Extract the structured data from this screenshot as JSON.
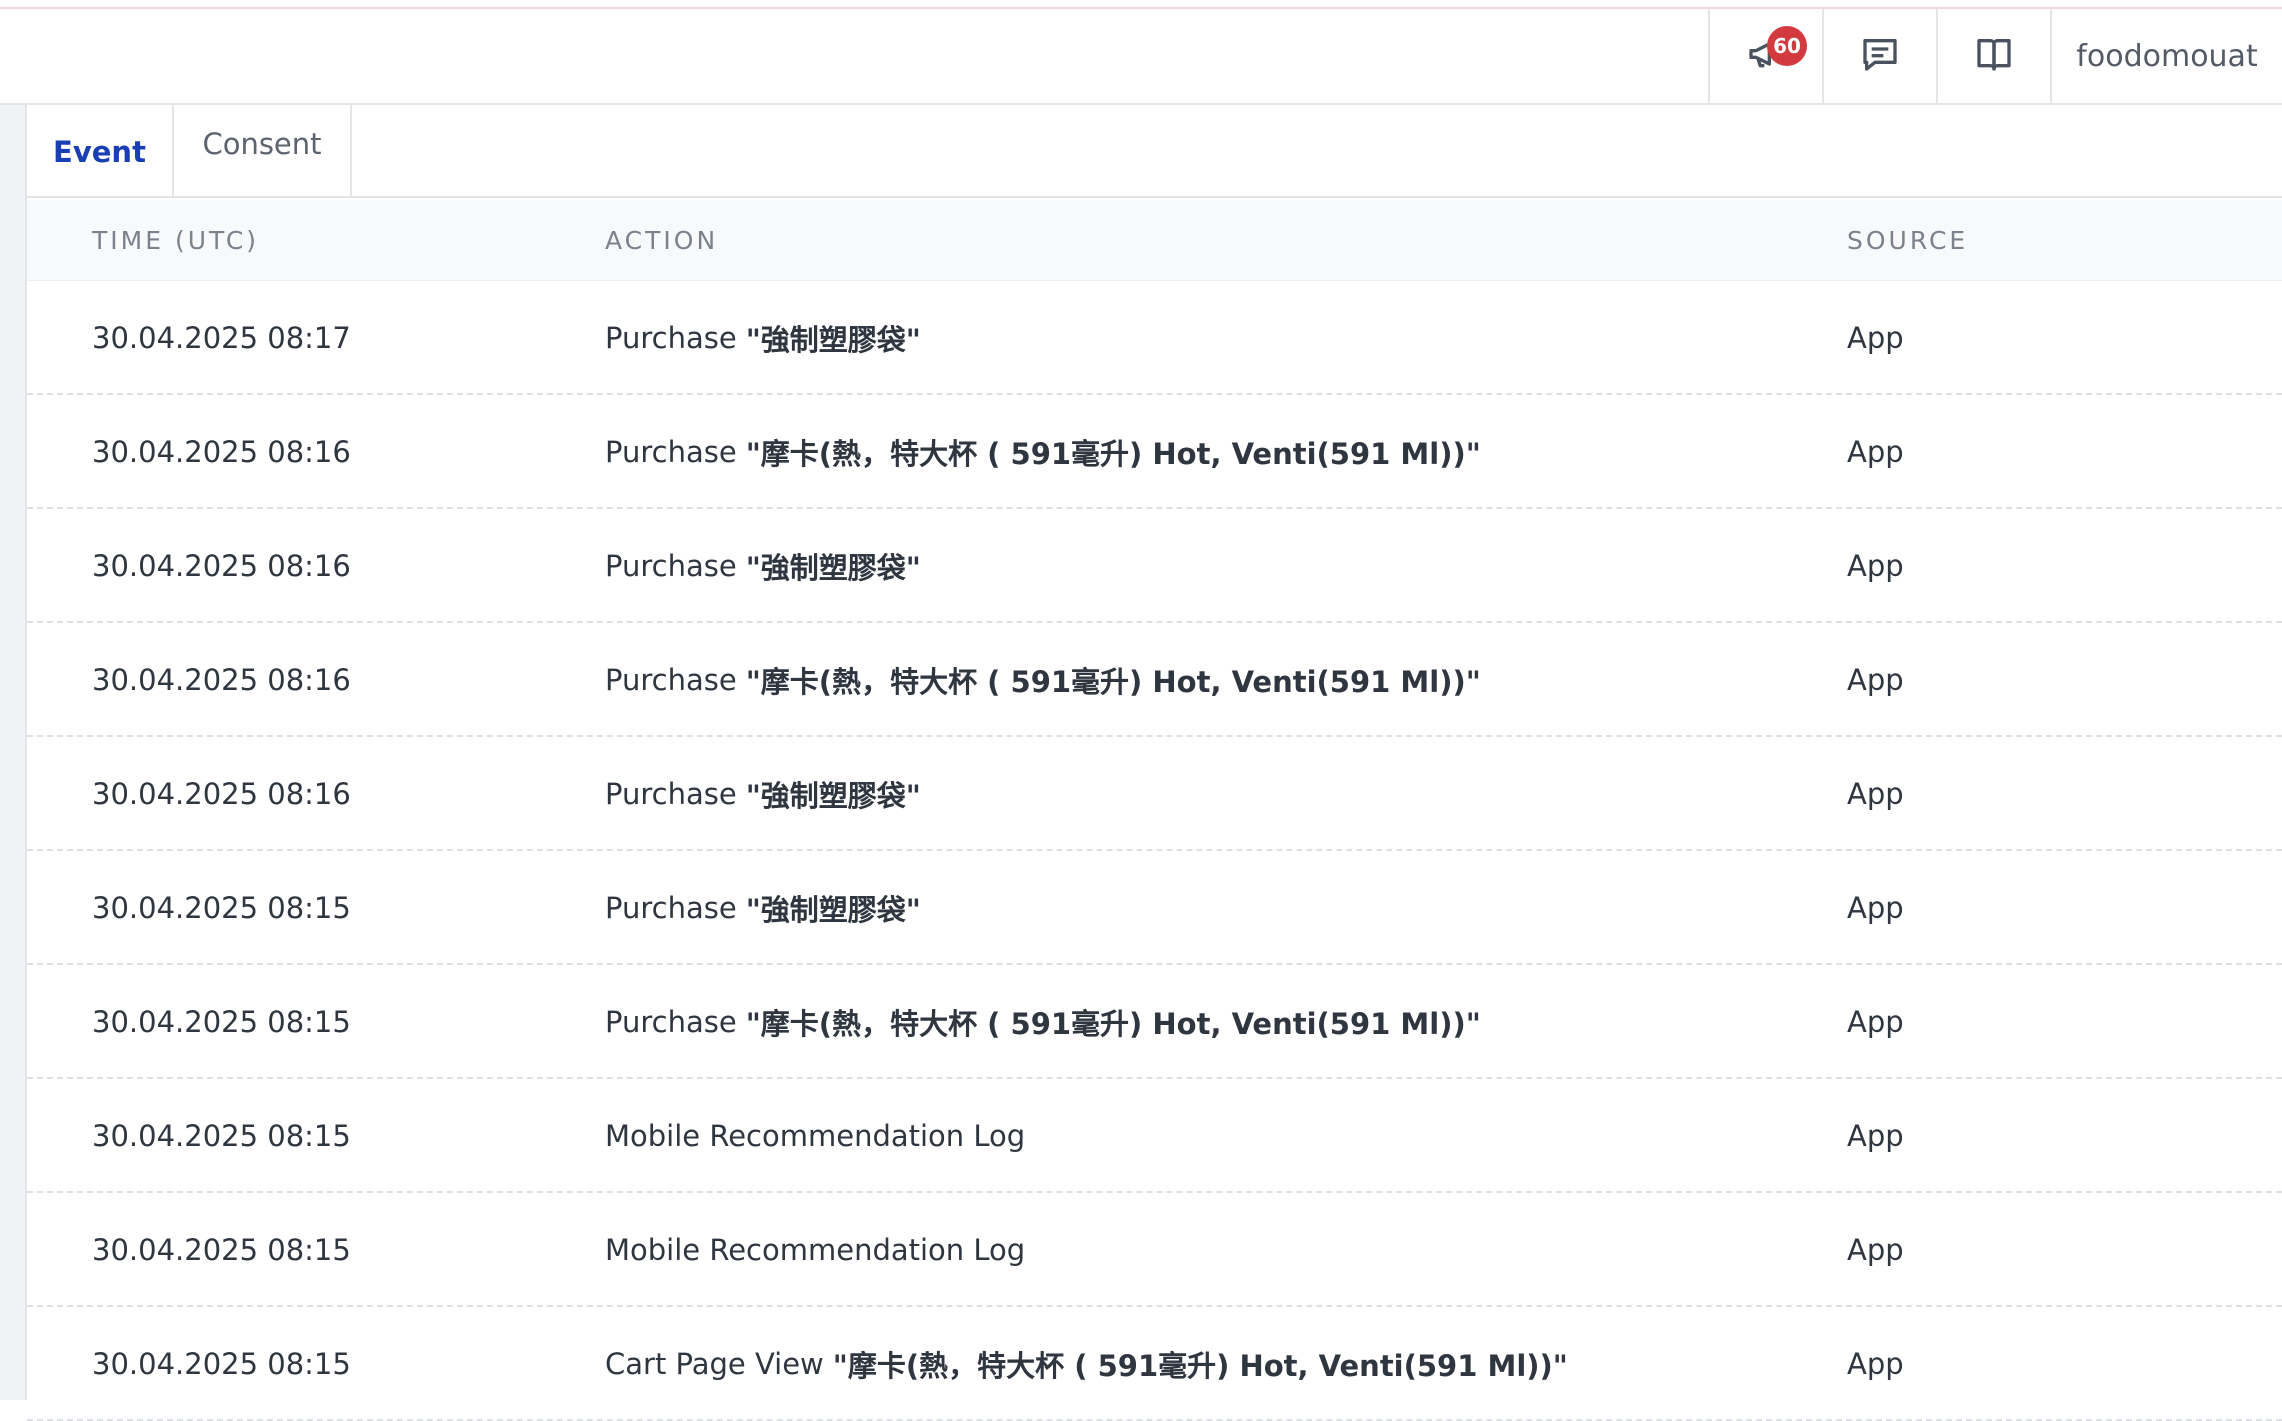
{
  "header": {
    "notification_count": "60",
    "username": "foodomouat"
  },
  "tabs": [
    {
      "label": "Event",
      "active": true
    },
    {
      "label": "Consent",
      "active": false
    }
  ],
  "table": {
    "columns": [
      "TIME (UTC)",
      "ACTION",
      "SOURCE"
    ],
    "rows": [
      {
        "time": "30.04.2025 08:17",
        "action": "Purchase",
        "item": "\"強制塑膠袋\"",
        "source": "App"
      },
      {
        "time": "30.04.2025 08:16",
        "action": "Purchase",
        "item": "\"摩卡(熱，特大杯 ( 591毫升) Hot, Venti(591 Ml))\"",
        "source": "App"
      },
      {
        "time": "30.04.2025 08:16",
        "action": "Purchase",
        "item": "\"強制塑膠袋\"",
        "source": "App"
      },
      {
        "time": "30.04.2025 08:16",
        "action": "Purchase",
        "item": "\"摩卡(熱，特大杯 ( 591毫升) Hot, Venti(591 Ml))\"",
        "source": "App"
      },
      {
        "time": "30.04.2025 08:16",
        "action": "Purchase",
        "item": "\"強制塑膠袋\"",
        "source": "App"
      },
      {
        "time": "30.04.2025 08:15",
        "action": "Purchase",
        "item": "\"強制塑膠袋\"",
        "source": "App"
      },
      {
        "time": "30.04.2025 08:15",
        "action": "Purchase",
        "item": "\"摩卡(熱，特大杯 ( 591毫升) Hot, Venti(591 Ml))\"",
        "source": "App"
      },
      {
        "time": "30.04.2025 08:15",
        "action": "Mobile Recommendation Log",
        "item": "",
        "source": "App"
      },
      {
        "time": "30.04.2025 08:15",
        "action": "Mobile Recommendation Log",
        "item": "",
        "source": "App"
      },
      {
        "time": "30.04.2025 08:15",
        "action": "Cart Page View",
        "item": "\"摩卡(熱，特大杯 ( 591毫升) Hot, Venti(591 Ml))\"",
        "source": "App"
      }
    ]
  }
}
